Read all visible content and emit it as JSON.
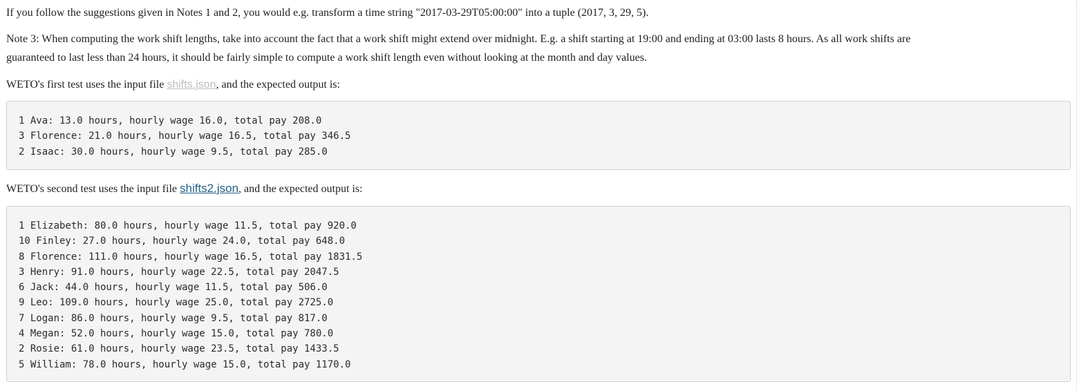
{
  "note_tuple": {
    "text": "If you follow the suggestions given in Notes 1 and 2, you would e.g. transform a time string \"2017-03-29T05:00:00\" into a tuple (2017, 3, 29, 5)."
  },
  "note3": {
    "line1": "Note 3: When computing the work shift lengths, take into account the fact that a work shift might extend over midnight. E.g. a shift starting at 19:00 and ending at 03:00 lasts 8 hours. As all work shifts are",
    "line2": "guaranteed to last less than 24 hours, it should be fairly simple to compute a work shift length even without looking at the month and day values."
  },
  "test1": {
    "intro_before": "WETO's first test uses the input file ",
    "link": "shifts.json",
    "intro_after": ", and the expected output is:",
    "output_lines": [
      "1 Ava: 13.0 hours, hourly wage 16.0, total pay 208.0",
      "3 Florence: 21.0 hours, hourly wage 16.5, total pay 346.5",
      "2 Isaac: 30.0 hours, hourly wage 9.5, total pay 285.0"
    ]
  },
  "test2": {
    "intro_before": "WETO's second test uses the input file ",
    "link": "shifts2.json",
    "intro_after": ", and the expected output is:",
    "output_lines": [
      "1 Elizabeth: 80.0 hours, hourly wage 11.5, total pay 920.0",
      "10 Finley: 27.0 hours, hourly wage 24.0, total pay 648.0",
      "8 Florence: 111.0 hours, hourly wage 16.5, total pay 1831.5",
      "3 Henry: 91.0 hours, hourly wage 22.5, total pay 2047.5",
      "6 Jack: 44.0 hours, hourly wage 11.5, total pay 506.0",
      "9 Leo: 109.0 hours, hourly wage 25.0, total pay 2725.0",
      "7 Logan: 86.0 hours, hourly wage 9.5, total pay 817.0",
      "4 Megan: 52.0 hours, hourly wage 15.0, total pay 780.0",
      "2 Rosie: 61.0 hours, hourly wage 23.5, total pay 1433.5",
      "5 William: 78.0 hours, hourly wage 15.0, total pay 1170.0"
    ]
  },
  "colors": {
    "link_visited": "#bdbdbd",
    "link_active": "#1f5f86",
    "code_background": "#f4f4f4"
  }
}
